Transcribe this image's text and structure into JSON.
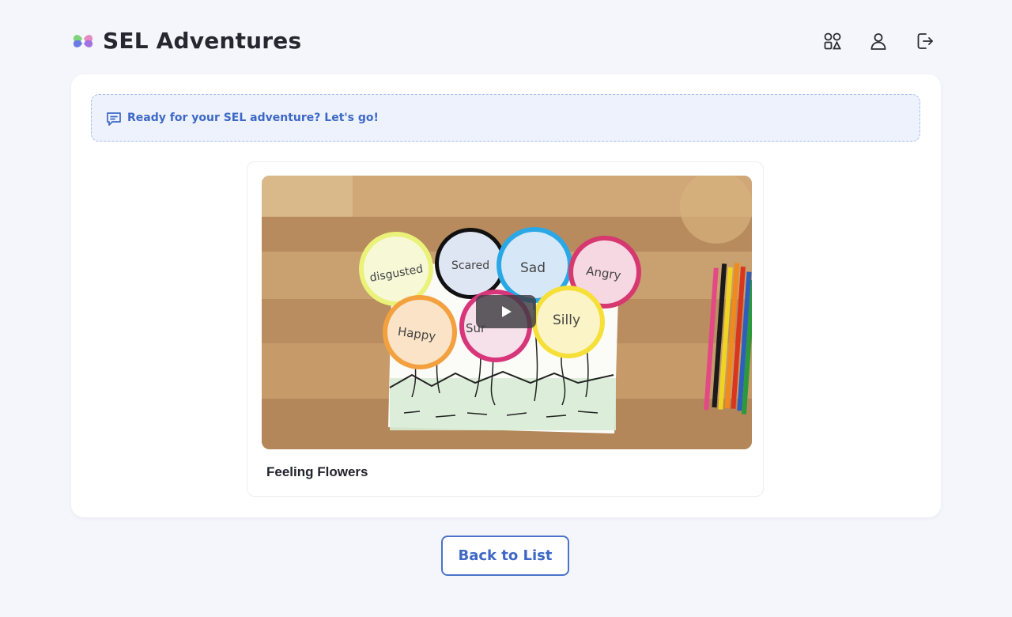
{
  "app": {
    "title": "SEL Adventures",
    "logo_icon": "colorful-heart-cross-logo"
  },
  "header": {
    "icons": [
      "grid-shapes-icon",
      "user-icon",
      "logout-icon"
    ]
  },
  "banner": {
    "icon": "chat-message-icon",
    "text": "Ready for your SEL adventure? Let's go!"
  },
  "video": {
    "title": "Feeling Flowers",
    "thumbnail_labels": [
      "disgusted",
      "Scared",
      "Sad",
      "Angry",
      "Happy",
      "Sur",
      "Silly"
    ],
    "play_icon": "play-icon"
  },
  "actions": {
    "back_label": "Back to List"
  },
  "colors": {
    "accent": "#3d68c6",
    "background": "#f5f6fb",
    "banner_bg": "#edf2fc"
  }
}
